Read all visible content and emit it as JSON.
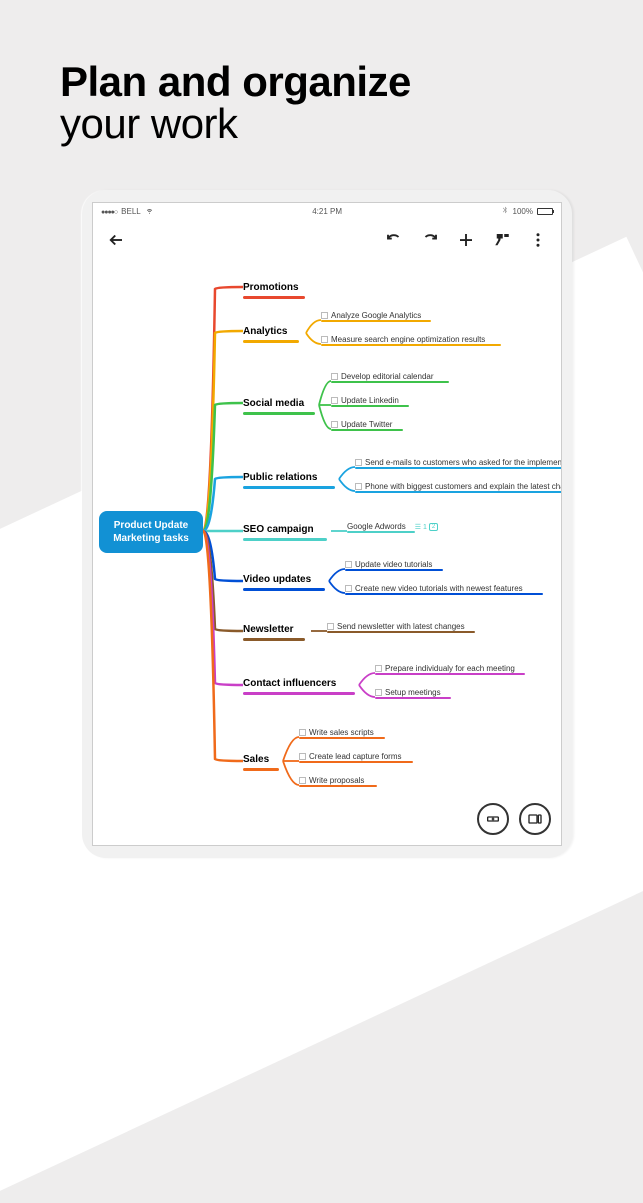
{
  "headline": {
    "line1": "Plan and organize",
    "line2": "your work"
  },
  "status": {
    "carrier": "BELL",
    "time": "4:21 PM",
    "battery": "100%"
  },
  "root": {
    "line1": "Product Update",
    "line2": "Marketing tasks"
  },
  "branches": {
    "promotions": {
      "label": "Promotions",
      "color": "#e8482e"
    },
    "analytics": {
      "label": "Analytics",
      "color": "#f2a900",
      "tasks": [
        "Analyze Google Analytics",
        "Measure search engine optimization results"
      ]
    },
    "social": {
      "label": "Social media",
      "color": "#3ec24b",
      "tasks": [
        "Develop editorial calendar",
        "Update Linkedin",
        "Update Twitter"
      ]
    },
    "pr": {
      "label": "Public relations",
      "color": "#1aa3e0",
      "tasks": [
        "Send e-mails to customers who asked for the implemented",
        "Phone with biggest customers and explain the latest chang"
      ]
    },
    "seo": {
      "label": "SEO campaign",
      "color": "#4dd0c8",
      "tasks": [
        "Google Adwords"
      ],
      "badge_count": "1",
      "badge_num": "2"
    },
    "video": {
      "label": "Video updates",
      "color": "#004fd6",
      "tasks": [
        "Update video tutorials",
        "Create new video tutorials with newest features"
      ]
    },
    "news": {
      "label": "Newsletter",
      "color": "#8a5a2a",
      "tasks": [
        "Send newsletter with latest changes"
      ]
    },
    "contact": {
      "label": "Contact influencers",
      "color": "#c93fc7",
      "tasks": [
        "Prepare individualy for each meeting",
        "Setup meetings"
      ]
    },
    "sales": {
      "label": "Sales",
      "color": "#f06a1a",
      "tasks": [
        "Write sales scripts",
        "Create lead capture forms",
        "Write proposals"
      ]
    }
  }
}
